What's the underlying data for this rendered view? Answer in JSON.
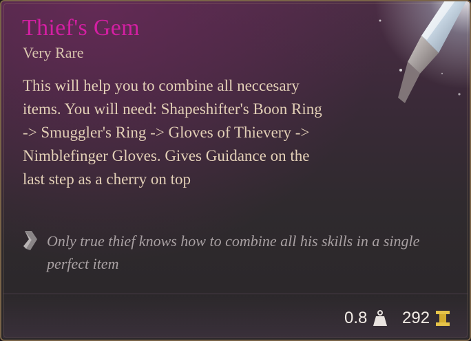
{
  "item": {
    "name": "Thief's Gem",
    "rarity": "Very Rare",
    "description": "This will help you to combine all neccesary items. You will need: Shapeshifter's Boon Ring -> Smuggler's Ring -> Gloves of Thievery -> Nimblefinger Gloves. Gives Guidance on the last step as a cherry on top",
    "flavor_text": "Only true thief knows how to combine all his skills in a single perfect item"
  },
  "stats": {
    "weight": "0.8",
    "weight_icon": "weight-icon",
    "value": "292",
    "value_icon": "gold-coin-icon"
  },
  "colors": {
    "title": "#d31fa2",
    "rarity": "#d7c3ad",
    "description": "#e2cfb6",
    "flavor": "#a8a0a2",
    "border": "#7a6448"
  },
  "icons": {
    "gem_art": "gem-crystal-icon",
    "flavor_icon": "quill-icon"
  }
}
